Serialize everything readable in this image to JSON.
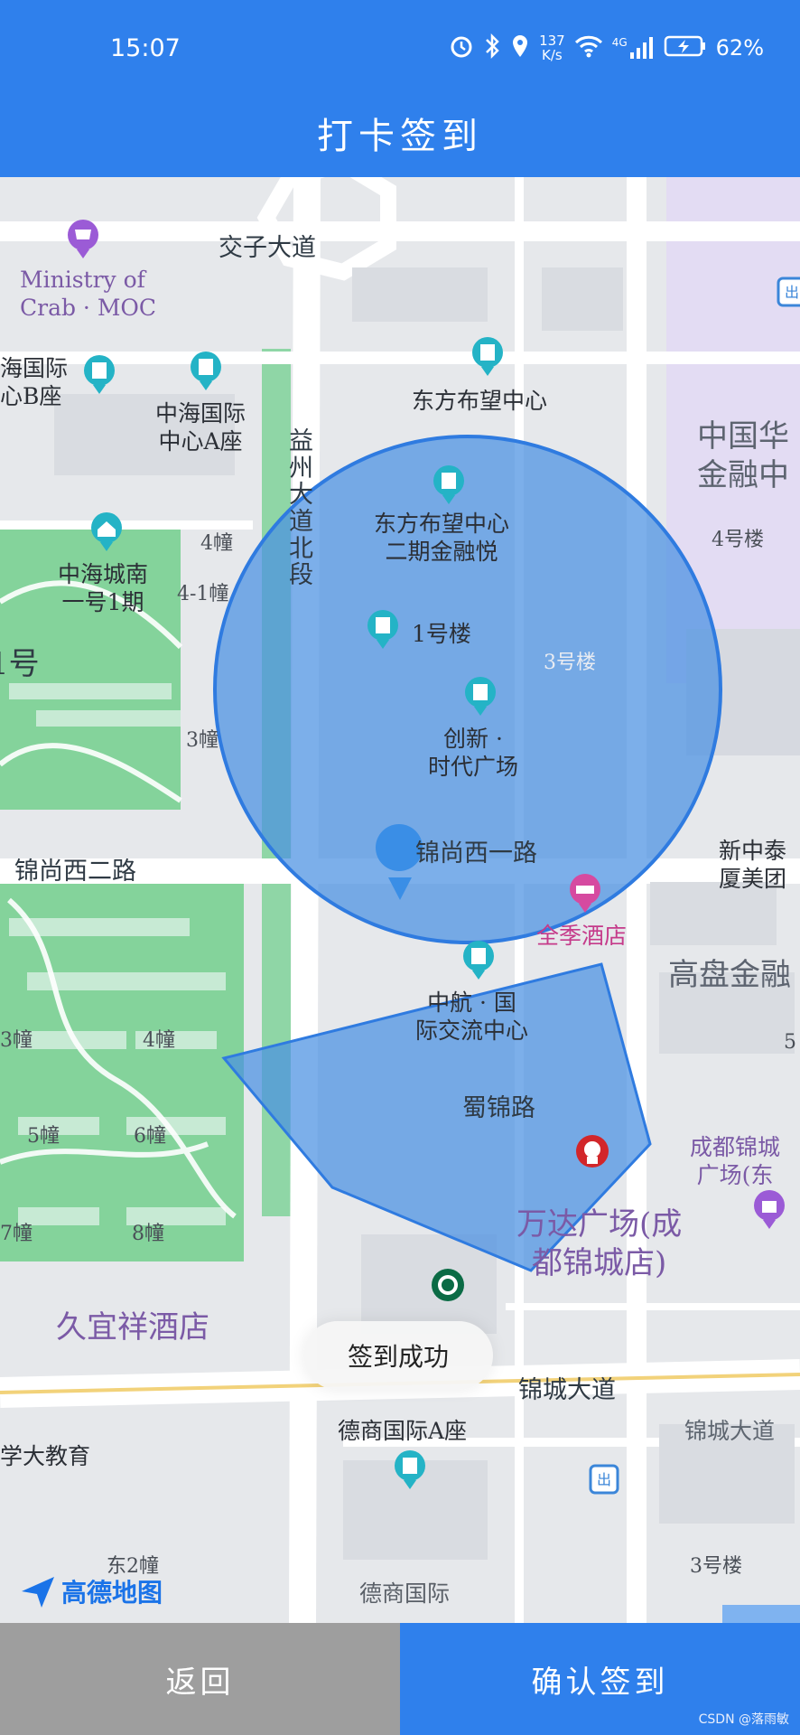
{
  "status_bar": {
    "time": "15:07",
    "net_speed_value": "137",
    "net_speed_unit": "K/s",
    "network_type": "4G",
    "battery": "62%"
  },
  "header": {
    "title": "打卡签到"
  },
  "map": {
    "provider_logo": "高德地图",
    "labels": {
      "jiaozi": "交子大道",
      "ministry": "Ministry of\nCrab · MOC",
      "zhonghai_b": "海国际\n心B座",
      "zhonghai_a": "中海国际\n中心A座",
      "dongfang": "东方布望中心",
      "zhongguohua": "中国华\n金融中",
      "yizhou": "益\n州\n大\n道\n北\n段",
      "building4": "4幢",
      "building4_1": "4-1幢",
      "building4_right": "4号楼",
      "zhonghai_chengnan": "中海城南\n一号1期",
      "hao": "1号",
      "dongfang_ii": "东方布望中心\n二期金融悦",
      "lou1": "1号楼",
      "lou3": "3号楼",
      "building3": "3幢",
      "chuangxin": "创新 ·\n时代广场",
      "jinshang_west2": "锦尚西二路",
      "jinshang_west1": "锦尚西一路",
      "xinzhongtai": "新中泰\n厦美团",
      "quanji": "全季酒店",
      "gaosheng": "高盘金融",
      "zhonghang": "中航 · 国\n际交流中心",
      "b3": "3幢",
      "b4": "4幢",
      "b5": "5幢",
      "b6": "6幢",
      "b7": "7幢",
      "b8": "8幢",
      "shujin": "蜀锦路",
      "chengdu_jincheng": "成都锦城\n广场(东",
      "wanda": "万达广场(成\n都锦城店)",
      "jiuyixiang": "久宜祥酒店",
      "jincheng_avenue": "锦城大道",
      "jincheng_avenue_r": "锦城大道",
      "deshang_a": "德商国际A座",
      "xue_jiaoyu": "学大教育",
      "dong2": "东2幢",
      "lou3_bottom": "3号楼",
      "deshang_bottom": "德商国际",
      "five_right": "5"
    }
  },
  "toast": {
    "text": "签到成功"
  },
  "bottom": {
    "back_label": "返回",
    "confirm_label": "确认签到",
    "watermark": "CSDN @落雨敏"
  },
  "colors": {
    "primary": "#2f80ec",
    "back_button": "#9e9e9e",
    "geofence_fill": "#4a90e2",
    "park_green": "#7fd39a",
    "poi_teal": "#24b3c6",
    "poi_purple": "#9b5bd6",
    "poi_pink": "#d64aa0"
  }
}
